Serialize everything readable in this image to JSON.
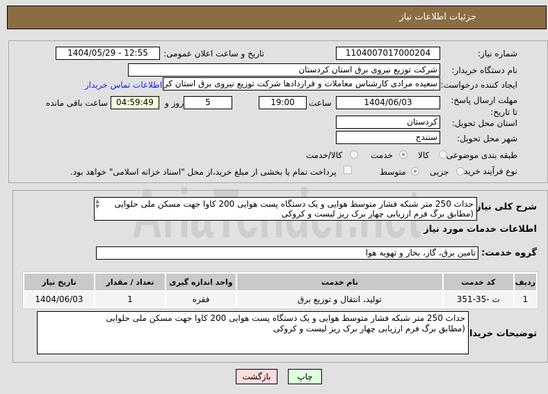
{
  "header": {
    "title": "جزئیات اطلاعات نیاز"
  },
  "form": {
    "need_number_label": "شماره نیاز:",
    "need_number": "1104007017000204",
    "announce_label": "تاریخ و ساعت اعلان عمومی:",
    "announce_value": "1404/05/29 - 12:55",
    "buyer_label": "نام دستگاه خریدار:",
    "buyer_value": "شرکت توزیع نیروی برق استان کردستان",
    "creator_label": "ایجاد کننده درخواست:",
    "creator_value": "سعیده مرادی کارشناس معاملات و قراردادها شرکت توزیع نیروی برق استان کردستان",
    "contact_link": "اطلاعات تماس خریدار",
    "deadline_label": "مهلت ارسال پاسخ: تا تاریخ:",
    "deadline_date": "1404/06/03",
    "time_label": "ساعت",
    "deadline_time": "19:00",
    "days": "5",
    "days_label": "روز و",
    "remaining": "04:59:49",
    "remaining_label": "ساعت باقی مانده",
    "province_label": "استان محل تحویل:",
    "province": "کردستان",
    "city_label": "شهر محل تحویل:",
    "city": "سنندج",
    "category_label": "طبقه بندی موضوعی:",
    "category_options": [
      "کالا",
      "خدمت",
      "کالا/خدمت"
    ],
    "category_selected": "خدمت",
    "process_label": "نوع فرآیند خرید :",
    "process_options": [
      "جزیی",
      "متوسط"
    ],
    "process_selected": "متوسط",
    "payment_note": "پرداخت تمام یا بخشی از مبلغ خرید،از محل \"اسناد خزانه اسلامی\" خواهد بود."
  },
  "details": {
    "desc_label": "شرح کلی نیاز:",
    "desc_line1": "حداث 250 متر شبکه فشار متوسط هوایی  و یک دستگاه پست هوایی 200 کاوا جهت مسکن ملی حلوایی",
    "desc_line2": "(مطابق  برگ فرم ارزیابی  چهار  برک ریز لیست  و کروکی",
    "services_title": "اطلاعات خدمات مورد نیاز",
    "group_label": "گروه خدمت:",
    "group_value": "تامین برق، گاز، بخار و تهویه هوا",
    "table": {
      "headers": [
        "ردیف",
        "کد خدمت",
        "نام خدمت",
        "واحد اندازه گیری",
        "تعداد / مقدار",
        "تاریخ نیاز"
      ],
      "rows": [
        [
          "1",
          "ت -35-351",
          "تولید، انتقال و توزیع برق",
          "فقره",
          "1",
          "1404/06/03"
        ]
      ]
    },
    "buyer_notes_label": "توضیحات خریدار:",
    "notes_line1": "حداث 250 متر شبکه فشار متوسط هوایی  و یک دستگاه پست هوایی 200 کاوا جهت مسکن ملی حلوایی",
    "notes_line2": "(مطابق  برگ فرم ارزیابی  چهار  برک ریز لیست  و کروکی"
  },
  "buttons": {
    "print": "چاپ",
    "back": "بازگشت"
  },
  "watermark": "AriaTender.net"
}
